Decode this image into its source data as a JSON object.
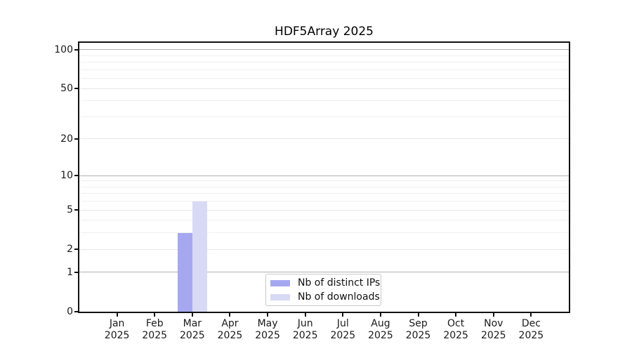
{
  "chart_data": {
    "type": "bar",
    "title": "HDF5Array 2025",
    "categories": [
      "Jan",
      "Feb",
      "Mar",
      "Apr",
      "May",
      "Jun",
      "Jul",
      "Aug",
      "Sep",
      "Oct",
      "Nov",
      "Dec"
    ],
    "year": "2025",
    "series": [
      {
        "name": "Nb of distinct IPs",
        "color": "#a5a8f0",
        "values": [
          0,
          0,
          3,
          0,
          0,
          0,
          0,
          0,
          0,
          0,
          0,
          0
        ]
      },
      {
        "name": "Nb of downloads",
        "color": "#d8daf5",
        "values": [
          0,
          0,
          6,
          0,
          0,
          0,
          0,
          0,
          0,
          0,
          0,
          0
        ]
      }
    ],
    "y_scale": "log1p",
    "ylim": [
      0,
      113
    ],
    "y_ticks": [
      0,
      1,
      2,
      5,
      10,
      20,
      50,
      100
    ],
    "y_decade_gridlines": [
      1,
      10,
      100
    ],
    "y_minor_gridlines": [
      3,
      4,
      6,
      7,
      8,
      9,
      30,
      40,
      60,
      70,
      80,
      90
    ],
    "grid": true,
    "legend": {
      "position": "bottom-center",
      "items": [
        {
          "label": "Nb of distinct IPs",
          "color": "#a5a8f0"
        },
        {
          "label": "Nb of downloads",
          "color": "#d8daf5"
        }
      ]
    }
  },
  "colors": {
    "background": "#ffffff",
    "axis": "#111111",
    "grid_minor": "#efefef",
    "grid_labeled": "#e6e6e6",
    "grid_decade": "#b0b0b0",
    "bar_distinct_ips": "#a5a8f0",
    "bar_downloads": "#d8daf5",
    "legend_border": "#c8c8c8",
    "text": "#1a1a1a"
  }
}
